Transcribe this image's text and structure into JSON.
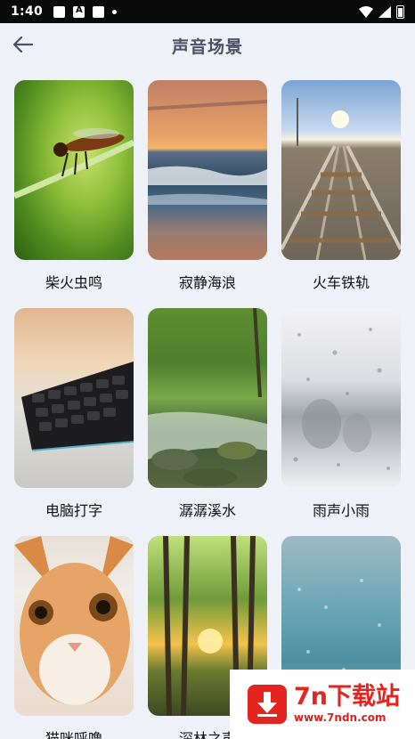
{
  "status_bar": {
    "time": "1:40"
  },
  "header": {
    "title": "声音场景",
    "back_icon": "arrow-left-icon"
  },
  "scenes": [
    {
      "label": "柴火虫鸣",
      "image": "insect-on-grass"
    },
    {
      "label": "寂静海浪",
      "image": "sunset-beach"
    },
    {
      "label": "火车铁轨",
      "image": "railway-tracks"
    },
    {
      "label": "电脑打字",
      "image": "mechanical-keyboard"
    },
    {
      "label": "潺潺溪水",
      "image": "forest-stream"
    },
    {
      "label": "雨声小雨",
      "image": "rainy-window"
    },
    {
      "label": "猫咪呼噜",
      "image": "orange-cat"
    },
    {
      "label": "深林之声",
      "image": "sunlit-forest"
    },
    {
      "label": "",
      "image": "water-splash"
    }
  ],
  "watermark": {
    "title": "7n下载站",
    "url": "www.7ndn.com"
  },
  "colors": {
    "background": "#eef1f7",
    "title": "#4a5068",
    "watermark_red": "#e3241f"
  }
}
